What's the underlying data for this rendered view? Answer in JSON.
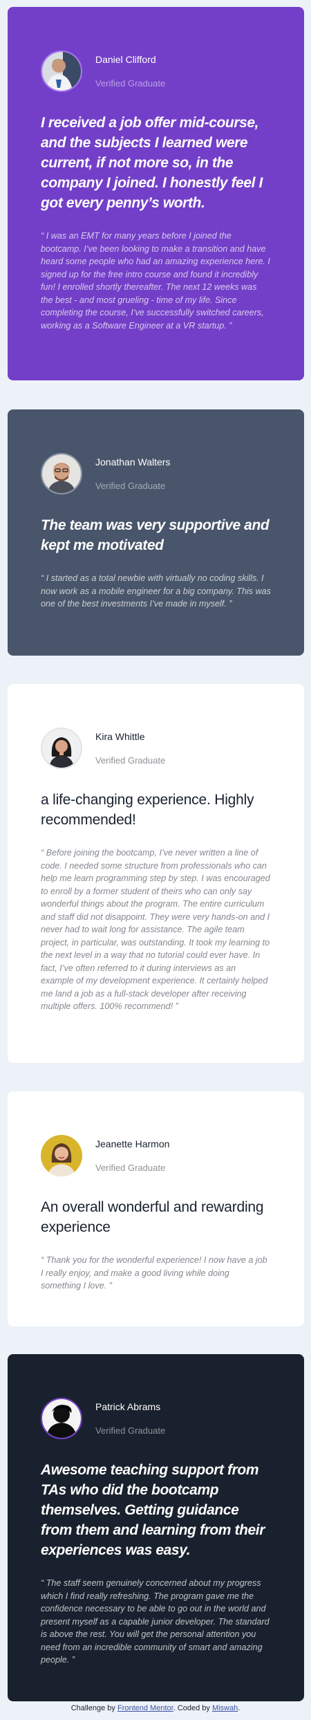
{
  "testimonials": [
    {
      "name": "Daniel Clifford",
      "role": "Verified Graduate",
      "headline": "I received a job offer mid-course, and the subjects I learned were current, if not more so, in the company I joined. I honestly feel I got every penny’s worth.",
      "quote": "“ I was an EMT for many years before I joined the bootcamp. I’ve been looking to make a transition and have heard some people who had an amazing experience here. I signed up for the free intro course and found it incredibly fun! I enrolled shortly thereafter. The next 12 weeks was the best - and most grueling - time of my life. Since completing the course, I’ve successfully switched careers, working as a Software Engineer at a VR startup. ”",
      "background": "#733FC8"
    },
    {
      "name": "Jonathan Walters",
      "role": "Verified Graduate",
      "headline": "The team was very supportive and kept me motivated",
      "quote": "“ I started as a total newbie with virtually no coding skills. I now work as a mobile engineer for a big company. This was one of the best investments I’ve made in myself. ”",
      "background": "#48556A"
    },
    {
      "name": "Kira Whittle",
      "role": "Verified Graduate",
      "headline": "a life-changing experience. Highly recommended!",
      "quote": "“ Before joining the bootcamp, I’ve never written a line of code. I needed some structure from professionals who can help me learn programming step by step. I was encouraged to enroll by a former student of theirs who can only say wonderful things about the program. The entire curriculum and staff did not disappoint. They were very hands-on and I never had to wait long for assistance. The agile team project, in particular, was outstanding. It took my learning to the next level in a way that no tutorial could ever have. In fact, I’ve often referred to it during interviews as an example of my development experience. It certainly helped me land a job as a full-stack developer after receiving multiple offers. 100% recommend! ”",
      "background": "#FFFFFF"
    },
    {
      "name": "Jeanette Harmon",
      "role": "Verified Graduate",
      "headline": "An overall wonderful and rewarding experience",
      "quote": "“ Thank you for the wonderful experience! I now have a job I really enjoy, and make a good living while doing something I love. ”",
      "background": "#FFFFFF"
    },
    {
      "name": "Patrick Abrams",
      "role": "Verified Graduate",
      "headline": "Awesome teaching support from TAs who did the bootcamp themselves. Getting guidance from them and learning from their experiences was easy.",
      "quote": "“ The staff seem genuinely concerned about my progress which I find really refreshing. The program gave me the confidence necessary to be able to go out in the world and present myself as a capable junior developer. The standard is above the rest. You will get the personal attention you need from an incredible community of smart and amazing people. ”",
      "background": "#19212E"
    }
  ],
  "footer": {
    "prefix": "Challenge by ",
    "link1": "Frontend Mentor",
    "middle": ". Coded by ",
    "link2": "Miswah",
    "suffix": "."
  },
  "colors": {
    "page_background": "#ECF2F8",
    "purple": "#733FC8",
    "grayish_blue": "#48556A",
    "dark_blackish_blue": "#19212E",
    "white": "#FFFFFF"
  }
}
